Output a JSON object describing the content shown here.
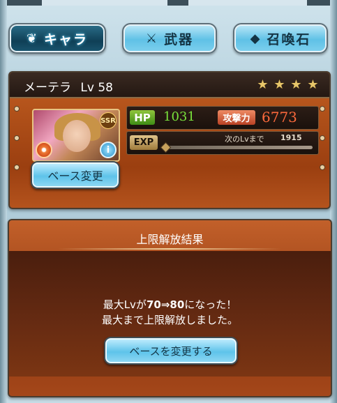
{
  "tabs": [
    {
      "label": "キャラ",
      "icon": "character-emblem-icon",
      "active": true
    },
    {
      "label": "武器",
      "icon": "crossed-swords-icon",
      "active": false
    },
    {
      "label": "召喚石",
      "icon": "summon-stone-icon",
      "active": false
    }
  ],
  "character": {
    "name": "メーテラ",
    "level_label": "Lv",
    "level": "58",
    "stars": 4,
    "rarity_badge": "SSR",
    "hp_label": "HP",
    "hp": "1031",
    "attack_label": "攻撃力",
    "attack": "6773",
    "exp_label": "EXP",
    "next_level_label": "次のLvまで",
    "next_level_exp": "1915",
    "base_button": "ベース変更"
  },
  "result": {
    "title": "上限解放結果",
    "line1_prefix": "最大Lvが",
    "line1_from": "70",
    "line1_arrow": "⇒",
    "line1_to": "80",
    "line1_suffix": "になった！",
    "line2": "最大まで上限解放しました。",
    "change_base_button": "ベースを変更する"
  },
  "colors": {
    "tab_active": "#0f3f56",
    "tab_inactive": "#5fc1e6",
    "panel_bg": "#9b3f10",
    "hp_value": "#79e33b",
    "attack_value": "#ff6a3c"
  }
}
